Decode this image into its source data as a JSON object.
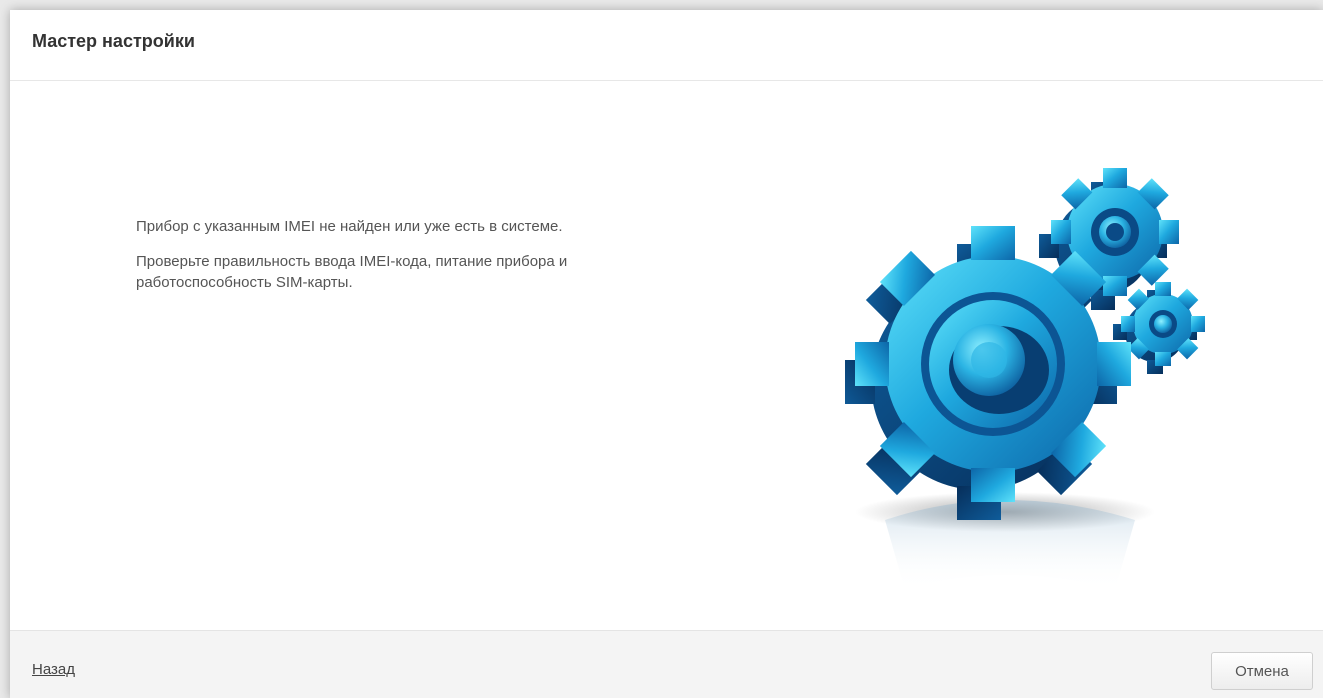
{
  "dialog": {
    "title": "Мастер настройки",
    "message": {
      "line1": "Прибор с указанным IMEI не найден или уже есть в системе.",
      "line2": "Проверьте правильность ввода IMEI-кода, питание прибора и работоспособность SIM-карты."
    },
    "illustration": {
      "icon": "gears-icon",
      "colors": {
        "light": "#3fd3f4",
        "mid": "#1a9fd8",
        "dark": "#0b4f8c"
      }
    },
    "footer": {
      "back_label": "Назад",
      "cancel_label": "Отмена"
    }
  }
}
